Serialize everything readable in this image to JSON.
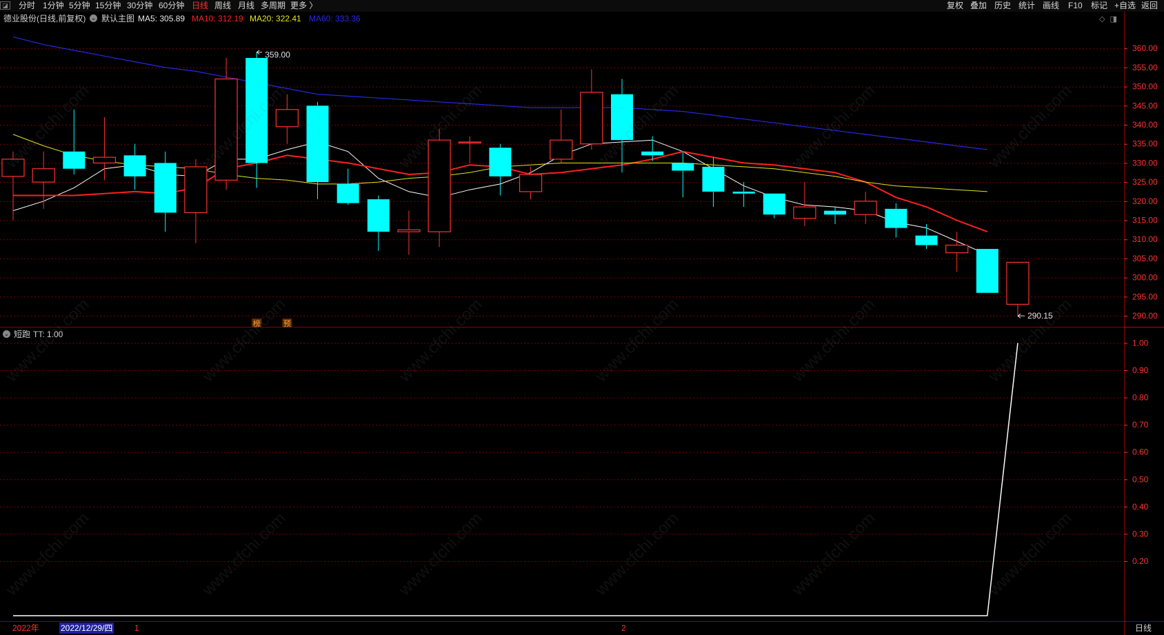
{
  "toolbar": {
    "left_items": [
      "分时",
      "1分钟",
      "5分钟",
      "15分钟",
      "30分钟",
      "60分钟",
      "日线",
      "周线",
      "月线",
      "多周期",
      "更多 〉"
    ],
    "active_item": "日线",
    "right_items": [
      "复权",
      "叠加",
      "历史",
      "统计",
      "画线",
      "F10",
      "标记",
      "+自选",
      "返回"
    ]
  },
  "main_header": {
    "title": "德业股份(日线,前复权)",
    "template": "默认主图",
    "ma5": "MA5: 305.89",
    "ma10": "MA10: 312.19",
    "ma20": "MA20: 322.41",
    "ma60": "MA60: 333.36"
  },
  "sub_header": {
    "name": "短跑",
    "value": "TT: 1.00"
  },
  "date_bar": {
    "year": "2022年",
    "cursor_date": "2022/12/29/四",
    "month1": "1",
    "month2": "2",
    "period": "日线"
  },
  "watermark": "www.cfchi.com",
  "colors": {
    "up": "#ff3232",
    "down": "#00ffff",
    "ma5": "#ffffff",
    "ma10": "#ff2020",
    "ma20": "#e6e61e",
    "ma60": "#2828e6",
    "grid": "#7a0000",
    "axis_text": "#ff3232",
    "tt_line": "#ffffff"
  },
  "chart_data": [
    {
      "type": "candlestick",
      "title": "德业股份(日线,前复权)",
      "y_ticks": [
        290,
        295,
        300,
        305,
        310,
        315,
        320,
        325,
        330,
        335,
        340,
        345,
        350,
        355,
        360
      ],
      "y_tick_labels": [
        "290.00",
        "295.00",
        "300.00",
        "305.00",
        "310.00",
        "315.00",
        "320.00",
        "325.00",
        "330.00",
        "335.00",
        "340.00",
        "345.00",
        "350.00",
        "355.00",
        "360.00"
      ],
      "ylim": [
        288,
        362
      ],
      "grid": true,
      "max_label": "359.00",
      "min_label": "290.15",
      "candles": [
        {
          "o": 326.5,
          "h": 333.0,
          "l": 315.0,
          "c": 331.0
        },
        {
          "o": 325.0,
          "h": 333.0,
          "l": 318.0,
          "c": 328.5
        },
        {
          "o": 333.0,
          "h": 344.0,
          "l": 327.0,
          "c": 328.5
        },
        {
          "o": 330.0,
          "h": 342.0,
          "l": 325.5,
          "c": 331.5
        },
        {
          "o": 332.0,
          "h": 335.0,
          "l": 323.0,
          "c": 326.5
        },
        {
          "o": 330.0,
          "h": 333.0,
          "l": 312.0,
          "c": 317.0
        },
        {
          "o": 317.0,
          "h": 331.0,
          "l": 309.0,
          "c": 329.0
        },
        {
          "o": 325.5,
          "h": 357.5,
          "l": 323.0,
          "c": 352.0
        },
        {
          "o": 357.5,
          "h": 359.0,
          "l": 323.5,
          "c": 330.0
        },
        {
          "o": 339.5,
          "h": 348.0,
          "l": 335.0,
          "c": 344.0
        },
        {
          "o": 345.0,
          "h": 346.0,
          "l": 320.5,
          "c": 325.0
        },
        {
          "o": 324.5,
          "h": 328.5,
          "l": 319.0,
          "c": 319.5
        },
        {
          "o": 320.5,
          "h": 321.5,
          "l": 307.0,
          "c": 312.0
        },
        {
          "o": 312.0,
          "h": 317.5,
          "l": 306.0,
          "c": 312.5
        },
        {
          "o": 312.0,
          "h": 339.0,
          "l": 308.0,
          "c": 336.0
        },
        {
          "o": 335.5,
          "h": 337.0,
          "l": 330.0,
          "c": 335.5
        },
        {
          "o": 334.0,
          "h": 335.0,
          "l": 321.5,
          "c": 326.5
        },
        {
          "o": 322.5,
          "h": 329.0,
          "l": 320.5,
          "c": 327.0
        },
        {
          "o": 331.0,
          "h": 344.0,
          "l": 330.0,
          "c": 336.0
        },
        {
          "o": 335.0,
          "h": 354.5,
          "l": 333.5,
          "c": 348.5
        },
        {
          "o": 348.0,
          "h": 352.0,
          "l": 327.5,
          "c": 336.0
        },
        {
          "o": 333.0,
          "h": 337.0,
          "l": 330.5,
          "c": 332.0
        },
        {
          "o": 330.0,
          "h": 333.0,
          "l": 321.0,
          "c": 328.0
        },
        {
          "o": 329.0,
          "h": 331.5,
          "l": 318.5,
          "c": 322.5
        },
        {
          "o": 322.5,
          "h": 325.0,
          "l": 318.5,
          "c": 322.0
        },
        {
          "o": 322.0,
          "h": 322.0,
          "l": 315.5,
          "c": 316.5
        },
        {
          "o": 315.5,
          "h": 325.0,
          "l": 313.5,
          "c": 318.5
        },
        {
          "o": 317.5,
          "h": 318.5,
          "l": 314.0,
          "c": 316.5
        },
        {
          "o": 316.5,
          "h": 322.5,
          "l": 314.0,
          "c": 320.0
        },
        {
          "o": 318.0,
          "h": 319.5,
          "l": 310.5,
          "c": 313.0
        },
        {
          "o": 311.0,
          "h": 314.0,
          "l": 307.5,
          "c": 308.5
        },
        {
          "o": 306.5,
          "h": 312.0,
          "l": 301.5,
          "c": 308.5
        },
        {
          "o": 307.5,
          "h": 307.5,
          "l": 296.0,
          "c": 296.0
        },
        {
          "o": 293.0,
          "h": 304.0,
          "l": 290.15,
          "c": 304.0
        }
      ],
      "series": [
        {
          "name": "MA5",
          "values": [
            317.5,
            320.0,
            323.5,
            328.5,
            329.5,
            327.0,
            326.5,
            331.0,
            331.0,
            333.5,
            335.5,
            333.0,
            326.0,
            322.5,
            321.0,
            323.0,
            324.5,
            327.5,
            332.0,
            335.0,
            335.5,
            336.0,
            333.0,
            328.5,
            324.0,
            321.0,
            319.0,
            318.5,
            317.5,
            314.5,
            313.0,
            309.5,
            306.0
          ]
        },
        {
          "name": "MA10",
          "values": [
            321.5,
            321.5,
            321.5,
            322.0,
            322.5,
            322.0,
            323.5,
            328.5,
            330.0,
            332.0,
            331.0,
            330.0,
            328.5,
            327.0,
            327.5,
            329.5,
            329.0,
            327.0,
            327.5,
            328.5,
            329.5,
            331.0,
            333.0,
            331.5,
            330.0,
            329.5,
            328.5,
            327.5,
            325.0,
            321.0,
            318.5,
            315.0,
            312.0
          ]
        },
        {
          "name": "MA20",
          "values": [
            337.5,
            334.5,
            332.0,
            330.5,
            329.5,
            329.0,
            328.5,
            327.0,
            326.0,
            325.5,
            324.5,
            324.5,
            325.0,
            326.0,
            326.5,
            327.5,
            329.0,
            329.5,
            330.0,
            330.0,
            330.0,
            330.0,
            330.0,
            329.5,
            329.0,
            328.5,
            327.5,
            326.5,
            325.0,
            324.0,
            323.5,
            323.0,
            322.5
          ]
        },
        {
          "name": "MA60",
          "values": [
            363.0,
            361.0,
            359.5,
            358.0,
            356.5,
            355.0,
            354.0,
            352.5,
            351.0,
            349.5,
            348.0,
            347.5,
            347.0,
            346.5,
            346.0,
            345.5,
            345.0,
            344.5,
            344.5,
            344.5,
            344.5,
            344.0,
            343.5,
            342.5,
            341.5,
            340.5,
            339.5,
            338.5,
            337.5,
            336.5,
            335.5,
            334.5,
            333.5
          ]
        }
      ],
      "markers": [
        {
          "candle": 8,
          "text": "榜"
        },
        {
          "candle": 9,
          "text": "预"
        }
      ]
    },
    {
      "type": "line",
      "title": "短跑",
      "y_ticks": [
        0.2,
        0.3,
        0.4,
        0.5,
        0.6,
        0.7,
        0.8,
        0.9,
        1.0
      ],
      "y_tick_labels": [
        "0.20",
        "0.30",
        "0.40",
        "0.50",
        "0.60",
        "0.70",
        "0.80",
        "0.90",
        "1.00"
      ],
      "ylim": [
        0,
        1.0
      ],
      "grid": true,
      "series": [
        {
          "name": "TT",
          "values": [
            0,
            0,
            0,
            0,
            0,
            0,
            0,
            0,
            0,
            0,
            0,
            0,
            0,
            0,
            0,
            0,
            0,
            0,
            0,
            0,
            0,
            0,
            0,
            0,
            0,
            0,
            0,
            0,
            0,
            0,
            0,
            0,
            0,
            1.0
          ]
        }
      ]
    }
  ]
}
